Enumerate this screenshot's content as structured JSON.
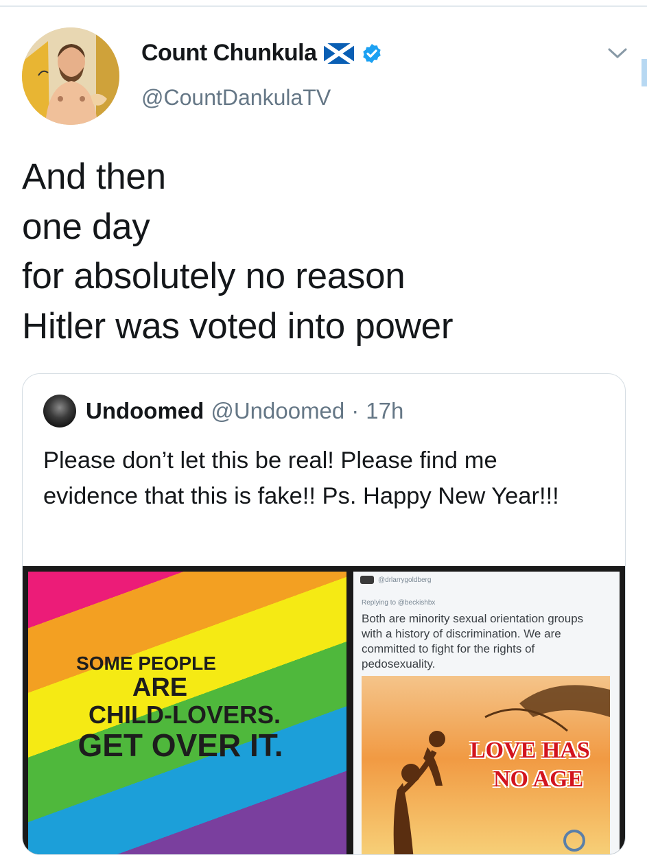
{
  "colors": {
    "verified_badge": "#1da1f2",
    "secondary_text": "#657786",
    "border": "#e1e8ed"
  },
  "author": {
    "name": "Count Chunkula",
    "handle": "@CountDankulaTV",
    "flag_icon": "scotland-flag-icon",
    "verified_icon": "verified-badge-icon",
    "menu_icon": "chevron-down-icon"
  },
  "tweet": {
    "text": "And then\none day\nfor absolutely no reason\nHitler was voted into power"
  },
  "quoted_tweet": {
    "name": "Undoomed",
    "handle": "@Undoomed",
    "separator": "·",
    "time": "17h",
    "text": "Please don’t let this be real! Please find me evidence that this is fake!! Ps. Happy New Year!!!",
    "media": {
      "left_image": {
        "line1": "SOME PEOPLE",
        "line2": "ARE",
        "line3": "CHILD-LOVERS.",
        "line4": "GET OVER IT."
      },
      "right_image": {
        "username": "@drlarrygoldberg",
        "replying_to": "Replying to @beckishbx",
        "text": "Both are minority sexual orientation groups with a history of discrimination. We are committed to fight for the rights of pedosexuality.",
        "poster_line1": "LOVE HAS",
        "poster_line2": "NO AGE"
      }
    }
  }
}
